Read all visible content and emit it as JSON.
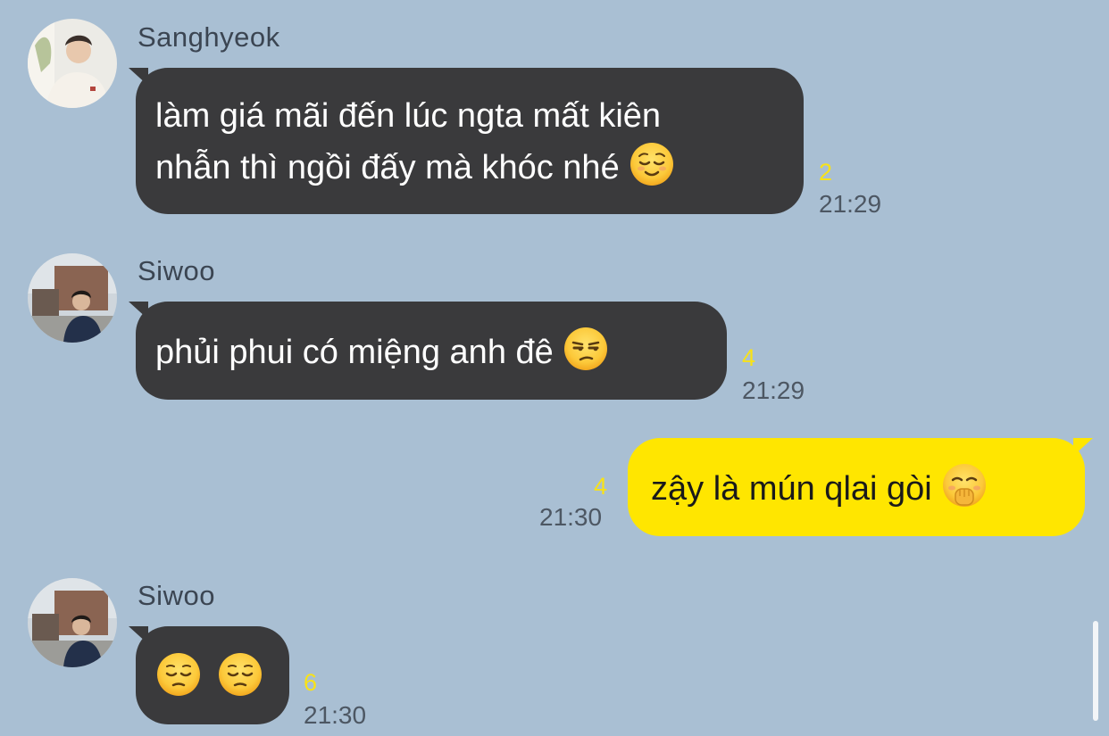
{
  "messages": [
    {
      "sender": "Sanghyeok",
      "line1": "làm giá mãi đến lúc ngta mất kiên",
      "line2": "nhẫn thì ngồi đấy mà khóc nhé",
      "emoji": "relieved-face",
      "unread": "2",
      "time": "21:29"
    },
    {
      "sender": "Siwoo",
      "text": "phủi phui có miệng anh đê",
      "emoji": "unamused-face",
      "unread": "4",
      "time": "21:29"
    },
    {
      "text": "zậy là mún qlai gòi",
      "emoji": "face-with-hand-over-mouth",
      "unread": "4",
      "time": "21:30"
    },
    {
      "sender": "Siwoo",
      "emojis": [
        "pensive-face",
        "pensive-face"
      ],
      "unread": "6",
      "time": "21:30"
    }
  ],
  "colors": {
    "background": "#a9bfd3",
    "incoming_bubble": "#3a3a3c",
    "outgoing_bubble": "#ffe600",
    "unread_count": "#f8e218"
  }
}
